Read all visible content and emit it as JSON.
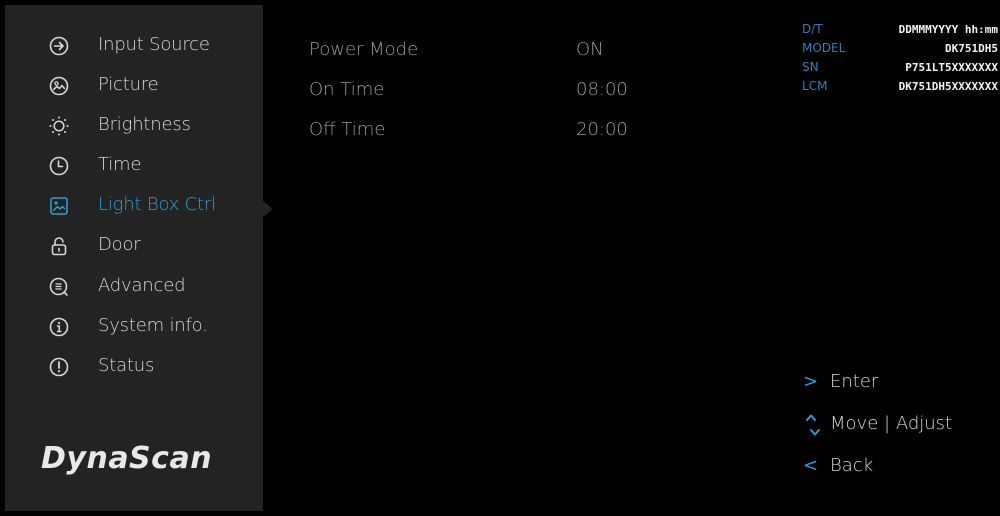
{
  "sidebar": {
    "items": [
      {
        "label": "Input Source",
        "icon": "input-source-icon"
      },
      {
        "label": "Picture",
        "icon": "picture-icon"
      },
      {
        "label": "Brightness",
        "icon": "brightness-icon"
      },
      {
        "label": "Time",
        "icon": "clock-icon"
      },
      {
        "label": "Light Box Ctrl",
        "icon": "light-box-icon",
        "active": true
      },
      {
        "label": "Door",
        "icon": "lock-icon"
      },
      {
        "label": "Advanced",
        "icon": "advanced-icon"
      },
      {
        "label": "System info.",
        "icon": "info-icon"
      },
      {
        "label": "Status",
        "icon": "exclamation-icon"
      }
    ],
    "logo": "DynaScan"
  },
  "settings": [
    {
      "label": "Power Mode",
      "value": "ON"
    },
    {
      "label": "On Time",
      "value": "08:00"
    },
    {
      "label": "Off Time",
      "value": "20:00"
    }
  ],
  "device_info": [
    {
      "key": "D/T",
      "value": "DDMMMYYYY hh:mm"
    },
    {
      "key": "MODEL",
      "value": "DK751DH5"
    },
    {
      "key": "SN",
      "value": "P751LT5XXXXXXX"
    },
    {
      "key": "LCM",
      "value": "DK751DH5XXXXXXX"
    }
  ],
  "hints": {
    "enter": {
      "icon": ">",
      "label": "Enter"
    },
    "move": {
      "label": "Move",
      "separator": "|",
      "label2": "Adjust"
    },
    "back": {
      "icon": "<",
      "label": "Back"
    }
  },
  "colors": {
    "accent": "#2f9bd6",
    "sidebar_bg": "#232323",
    "background": "#000000",
    "text": "#d7d7d7",
    "setting_text": "#9a9a9a"
  }
}
